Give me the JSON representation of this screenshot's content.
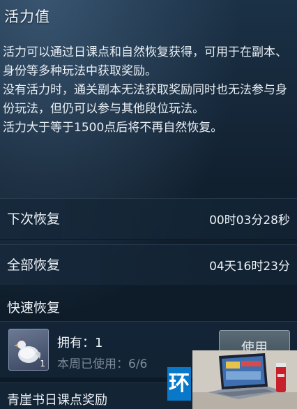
{
  "title": "活力值",
  "description": [
    "活力可以通过日课点和自然恢复获得，可用于在副本、身份等多种玩法中获取奖励。",
    "没有活力时，通关副本无法获取奖励同时也无法参与身份玩法，但仍可以参与其他段位玩法。",
    "活力大于等于1500点后将不再自然恢复。"
  ],
  "next_recovery": {
    "label": "下次恢复",
    "value": "00时03分28秒"
  },
  "full_recovery": {
    "label": "全部恢复",
    "value": "04天16时23分"
  },
  "quick_recovery": {
    "section_label": "快速恢复",
    "item_count": "1",
    "owned": "拥有：1",
    "used": "本周已使用：6/6",
    "use_button": "使用"
  },
  "reward_row": {
    "label": "青崖书日课点奖励"
  },
  "ad_logo": "环",
  "colors": {
    "background": "#11202f",
    "row": "#16283a",
    "muted_text": "#7d8b99",
    "ad_logo": "#0a78c8"
  },
  "icons": {
    "item": "chicken-item-icon"
  }
}
